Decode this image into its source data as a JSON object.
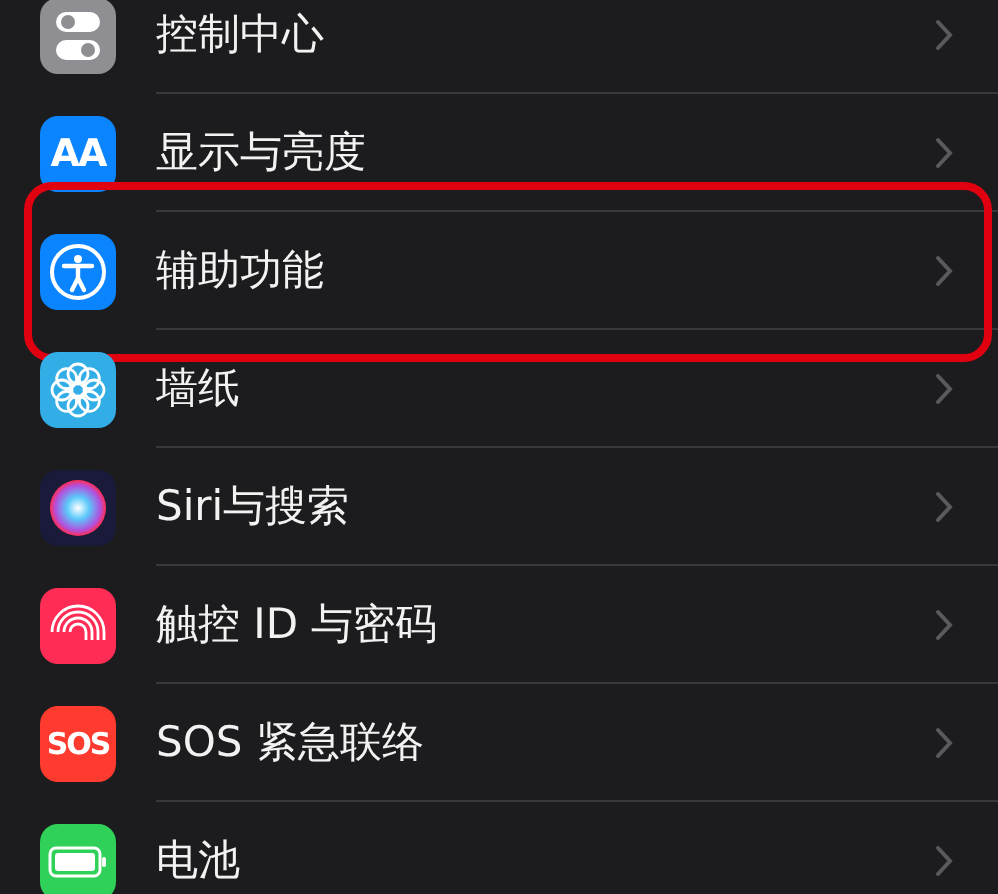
{
  "settings_items": [
    {
      "kind": "control-center",
      "label": "控制中心"
    },
    {
      "kind": "display",
      "label": "显示与亮度",
      "icon_text": "AA"
    },
    {
      "kind": "accessibility",
      "label": "辅助功能",
      "highlighted": true
    },
    {
      "kind": "wallpaper",
      "label": "墙纸"
    },
    {
      "kind": "siri",
      "label": "Siri与搜索"
    },
    {
      "kind": "touch-id",
      "label": "触控 ID 与密码"
    },
    {
      "kind": "sos",
      "label": "SOS 紧急联络",
      "icon_text": "SOS"
    },
    {
      "kind": "battery",
      "label": "电池"
    }
  ]
}
